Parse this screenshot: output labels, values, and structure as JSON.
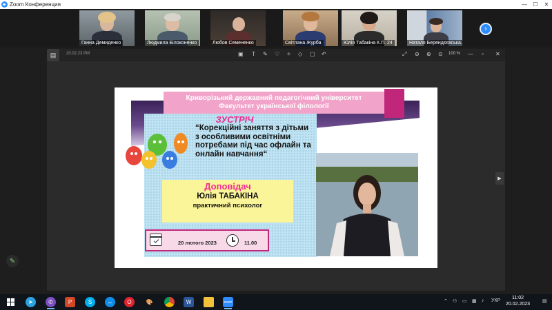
{
  "window": {
    "title": "Zoom Конференция",
    "minimize": "—",
    "maximize": "☐",
    "close": "✕"
  },
  "gallery": {
    "participants": [
      {
        "name": "Ганна Демиденко",
        "active": false
      },
      {
        "name": "Людмила Білоконенко",
        "active": true
      },
      {
        "name": "Любов Семененко",
        "active": false
      },
      {
        "name": "Світлана Журба",
        "active": false
      },
      {
        "name": "Юлія Табакіна К.П. 24",
        "active": false
      },
      {
        "name": "Наталя Берендєєвська...",
        "active": false
      }
    ],
    "next_icon": "›"
  },
  "share_toolbar": {
    "time": "20.02.23 PM",
    "zoom_level": "100 %"
  },
  "slide": {
    "university": "Криворізький державний педагогічний університет",
    "faculty": "Факультет української філології",
    "meeting": "ЗУСТРІЧ",
    "topic": "“Корекційні заняття з дітьми з особливими освітніми потребами під час офлайн та онлайн навчання“",
    "speaker_label": "Доповідач",
    "speaker_name": "Юлія ТАБАКІНА",
    "speaker_role": "практичний психолог",
    "date": "20 лютого 2023",
    "time": "11.00"
  },
  "taskbar": {
    "language": "УКР",
    "clock_time": "11:02",
    "clock_date": "20.02.2023"
  },
  "colors": {
    "zoom_blue": "#2d8cff",
    "slide_pink": "#ef2a8f",
    "slide_magenta": "#c0267a",
    "active_speaker": "#8bd443"
  }
}
